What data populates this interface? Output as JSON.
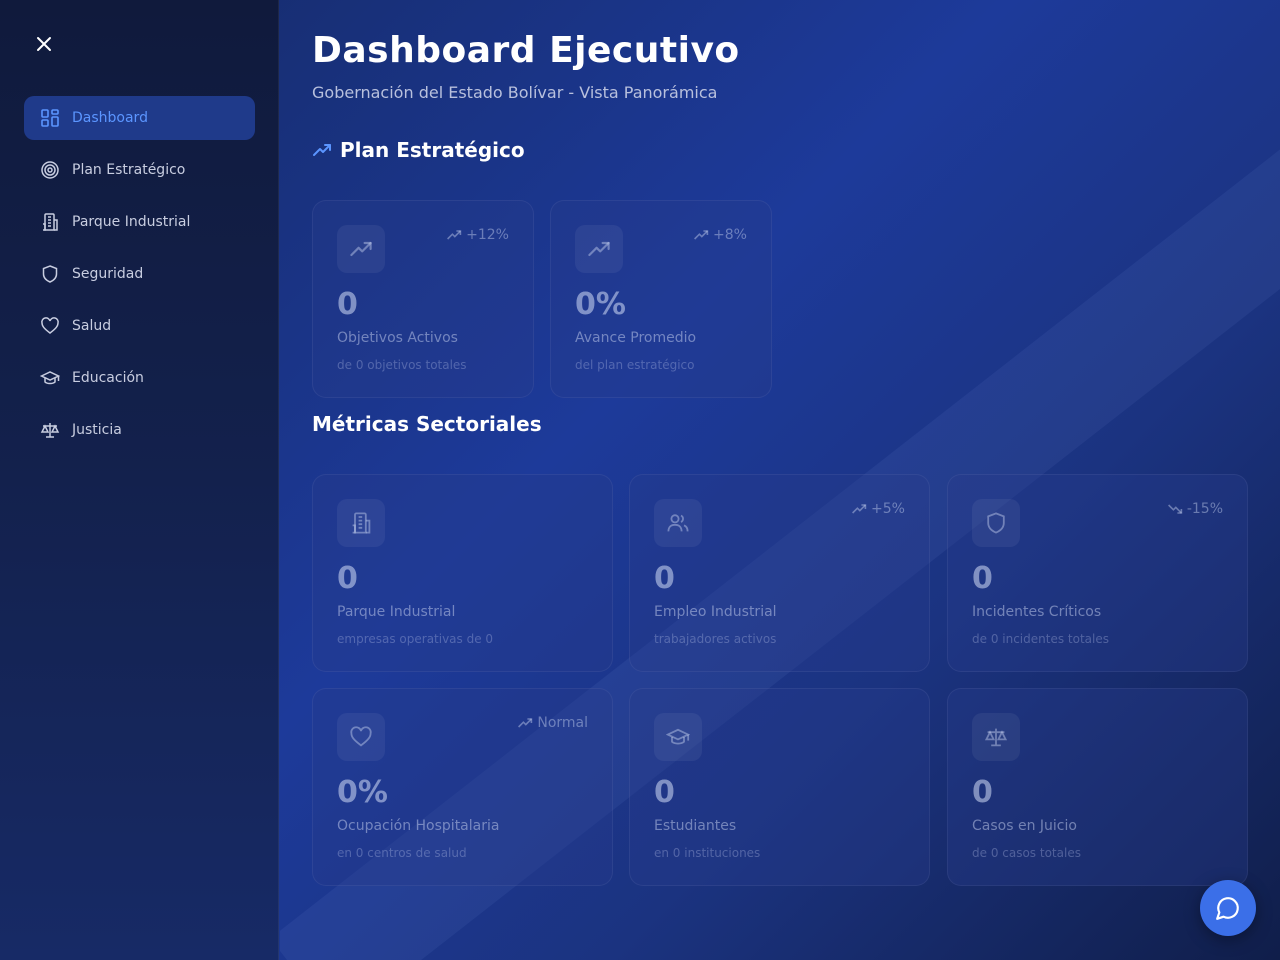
{
  "header": {
    "title": "Dashboard Ejecutivo",
    "subtitle": "Gobernación del Estado Bolívar - Vista Panorámica"
  },
  "sidebar": {
    "items": [
      {
        "label": "Dashboard",
        "icon": "grid-icon",
        "active": true
      },
      {
        "label": "Plan Estratégico",
        "icon": "target-icon"
      },
      {
        "label": "Parque Industrial",
        "icon": "building-icon"
      },
      {
        "label": "Seguridad",
        "icon": "shield-icon"
      },
      {
        "label": "Salud",
        "icon": "heart-icon"
      },
      {
        "label": "Educación",
        "icon": "graduation-cap-icon"
      },
      {
        "label": "Justicia",
        "icon": "scale-icon"
      }
    ]
  },
  "sections": {
    "plan": "Plan Estratégico",
    "metrics": "Métricas Sectoriales"
  },
  "plan_cards": [
    {
      "icon": "trending-up-icon",
      "trend": "+12%",
      "value": "0",
      "label": "Objetivos Activos",
      "sub": "de 0 objetivos totales"
    },
    {
      "icon": "trending-up-icon",
      "trend": "+8%",
      "value": "0%",
      "label": "Avance Promedio",
      "sub": "del plan estratégico"
    }
  ],
  "metric_cards": [
    {
      "icon": "building-icon",
      "trend": "",
      "value": "0",
      "label": "Parque Industrial",
      "sub": "empresas operativas de 0"
    },
    {
      "icon": "users-icon",
      "trend": "+5%",
      "value": "0",
      "label": "Empleo Industrial",
      "sub": "trabajadores activos"
    },
    {
      "icon": "shield-icon",
      "trend": "-15%",
      "value": "0",
      "label": "Incidentes Críticos",
      "sub": "de 0 incidentes totales"
    },
    {
      "icon": "heart-icon",
      "trend": "Normal",
      "value": "0%",
      "label": "Ocupación Hospitalaria",
      "sub": "en 0 centros de salud"
    },
    {
      "icon": "graduation-cap-icon",
      "trend": "",
      "value": "0",
      "label": "Estudiantes",
      "sub": "en 0 instituciones"
    },
    {
      "icon": "scale-icon",
      "trend": "",
      "value": "0",
      "label": "Casos en Juicio",
      "sub": "de 0 casos totales"
    }
  ],
  "colors": {
    "accent": "#5b95ff",
    "active_bg": "#1f3a8a",
    "chat_button": "#3b6fe8"
  }
}
